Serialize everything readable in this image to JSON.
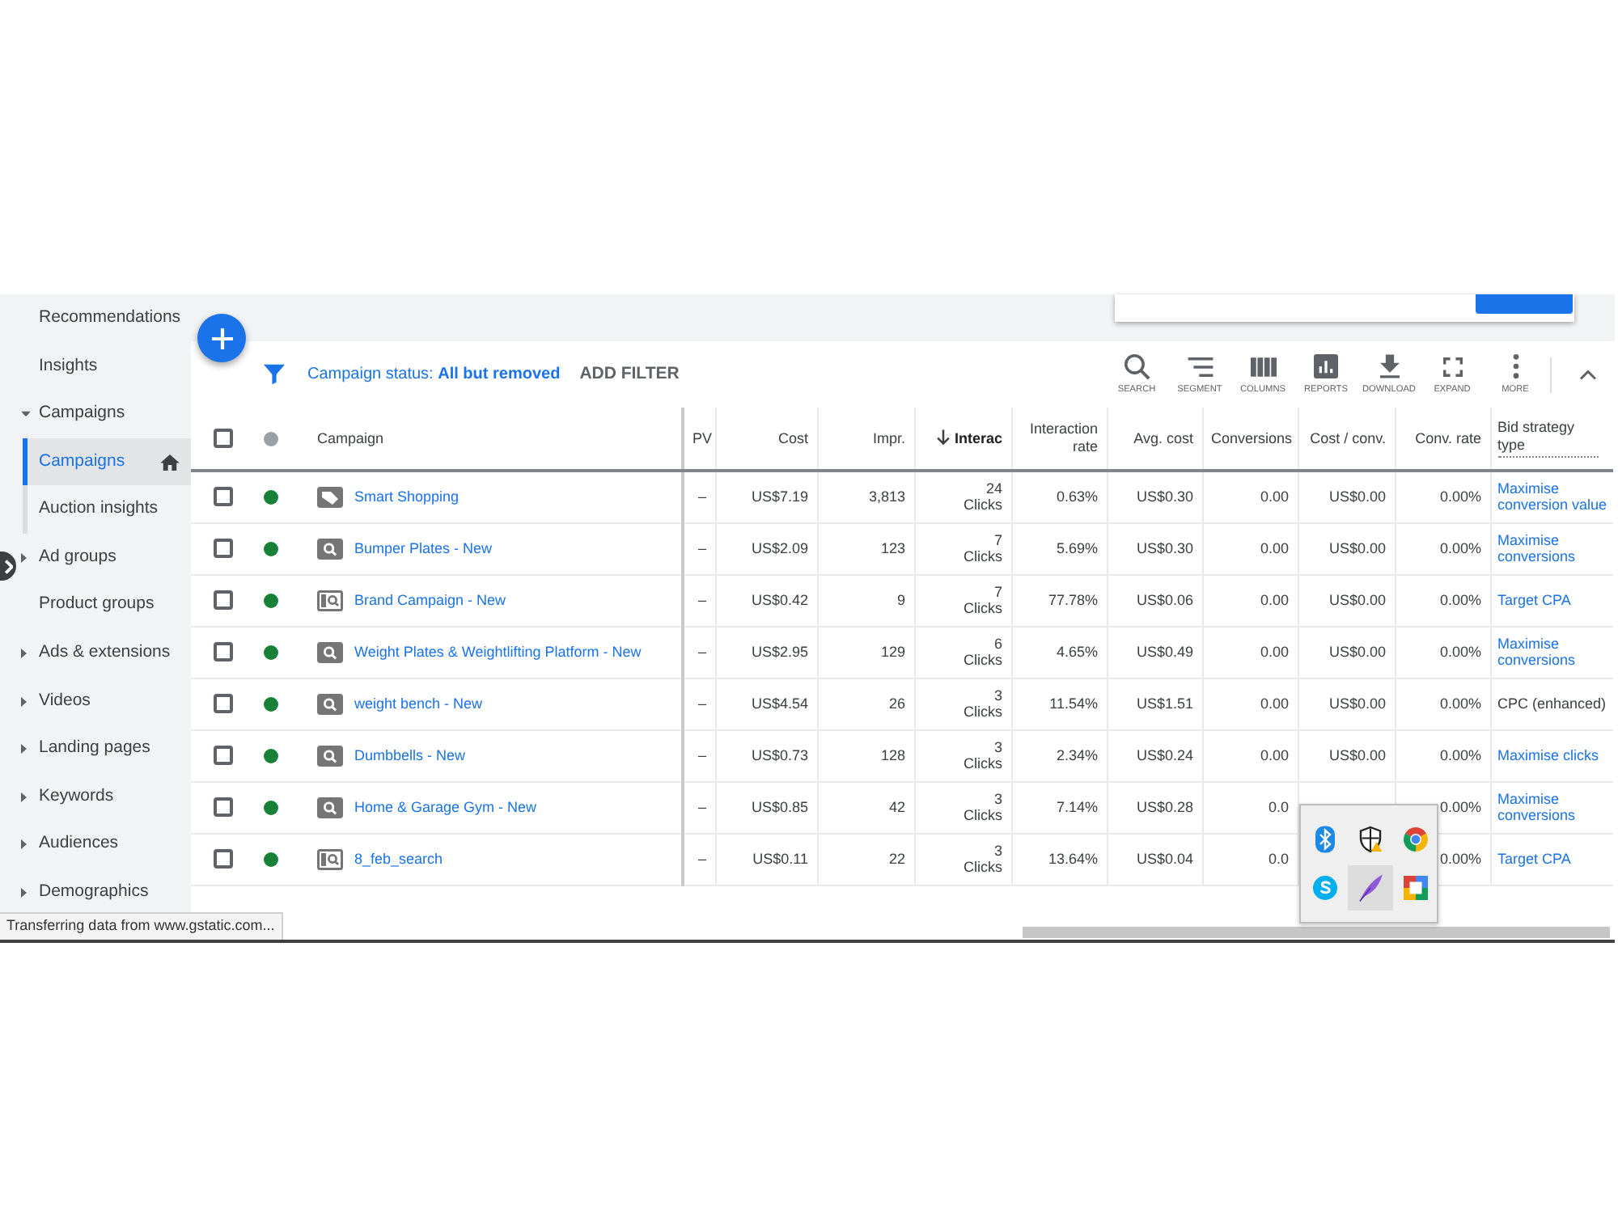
{
  "sidebar": {
    "items": [
      {
        "label": "Recommendations",
        "kind": "page",
        "selected": false
      },
      {
        "label": "Insights",
        "kind": "page",
        "selected": false
      },
      {
        "label": "Campaigns",
        "kind": "section",
        "expanded": true,
        "selected": false,
        "children": [
          {
            "label": "Campaigns",
            "selected": true,
            "home": true
          },
          {
            "label": "Auction insights",
            "selected": false,
            "home": false
          }
        ]
      },
      {
        "label": "Ad groups",
        "kind": "section",
        "expanded": false,
        "selected": false
      },
      {
        "label": "Product groups",
        "kind": "page",
        "selected": false
      },
      {
        "label": "Ads & extensions",
        "kind": "section",
        "expanded": false,
        "selected": false
      },
      {
        "label": "Videos",
        "kind": "section",
        "expanded": false,
        "selected": false
      },
      {
        "label": "Landing pages",
        "kind": "section",
        "expanded": false,
        "selected": false
      },
      {
        "label": "Keywords",
        "kind": "section",
        "expanded": false,
        "selected": false
      },
      {
        "label": "Audiences",
        "kind": "section",
        "expanded": false,
        "selected": false
      },
      {
        "label": "Demographics",
        "kind": "section",
        "expanded": false,
        "selected": false
      }
    ]
  },
  "filter_bar": {
    "filter": "Campaign status: **All but removed**",
    "add_filter": "ADD FILTER"
  },
  "toolbar": {
    "buttons": [
      {
        "kind": "search",
        "label": "SEARCH"
      },
      {
        "kind": "segment",
        "label": "SEGMENT"
      },
      {
        "kind": "columns",
        "label": "COLUMNS"
      },
      {
        "kind": "reports",
        "label": "REPORTS"
      },
      {
        "kind": "download",
        "label": "DOWNLOAD"
      },
      {
        "kind": "expand",
        "label": "EXPAND"
      },
      {
        "kind": "more",
        "label": "MORE"
      }
    ]
  },
  "table": {
    "header_checkbox": {
      "checked": false
    },
    "columns": [
      {
        "label": "Campaign",
        "kind": "name",
        "sorted": false
      },
      {
        "label": "PV",
        "kind": "number",
        "sorted": false
      },
      {
        "label": "Cost",
        "kind": "number",
        "sorted": false
      },
      {
        "label": "Impr.",
        "kind": "number",
        "sorted": false
      },
      {
        "label": "Interac",
        "kind": "number",
        "sorted": true
      },
      {
        "label": "Interaction rate",
        "kind": "number",
        "sorted": false
      },
      {
        "label": "Avg. cost",
        "kind": "number",
        "sorted": false
      },
      {
        "label": "Conversions",
        "kind": "number",
        "sorted": false
      },
      {
        "label": "Cost / conv.",
        "kind": "number",
        "sorted": false
      },
      {
        "label": "Conv. rate",
        "kind": "number",
        "sorted": false
      },
      {
        "label": "Bid strategy type",
        "kind": "strategy",
        "sorted": false
      }
    ],
    "rows": [
      {
        "selected": false,
        "enabled": true,
        "kind": "shopping",
        "name": "Smart Shopping",
        "pv": "–",
        "cost": "US$7.19",
        "impr": "3,813",
        "interactions": "24",
        "interaction_unit": "Clicks",
        "interaction_rate": "0.63%",
        "avg_cost": "US$0.30",
        "conversions": "0.00",
        "cost_per_conv": "US$0.00",
        "conv_rate": "0.00%",
        "bid_strategy": "Maximise conversion value",
        "bid_strategy_link": true
      },
      {
        "selected": false,
        "enabled": true,
        "kind": "search",
        "name": "Bumper Plates - New",
        "pv": "–",
        "cost": "US$2.09",
        "impr": "123",
        "interactions": "7",
        "interaction_unit": "Clicks",
        "interaction_rate": "5.69%",
        "avg_cost": "US$0.30",
        "conversions": "0.00",
        "cost_per_conv": "US$0.00",
        "conv_rate": "0.00%",
        "bid_strategy": "Maximise conversions",
        "bid_strategy_link": true
      },
      {
        "selected": false,
        "enabled": true,
        "kind": "search_display",
        "name": "Brand Campaign - New",
        "pv": "–",
        "cost": "US$0.42",
        "impr": "9",
        "interactions": "7",
        "interaction_unit": "Clicks",
        "interaction_rate": "77.78%",
        "avg_cost": "US$0.06",
        "conversions": "0.00",
        "cost_per_conv": "US$0.00",
        "conv_rate": "0.00%",
        "bid_strategy": "Target CPA",
        "bid_strategy_link": true
      },
      {
        "selected": false,
        "enabled": true,
        "kind": "search",
        "name": "Weight Plates & Weightlifting Platform - New",
        "pv": "–",
        "cost": "US$2.95",
        "impr": "129",
        "interactions": "6",
        "interaction_unit": "Clicks",
        "interaction_rate": "4.65%",
        "avg_cost": "US$0.49",
        "conversions": "0.00",
        "cost_per_conv": "US$0.00",
        "conv_rate": "0.00%",
        "bid_strategy": "Maximise conversions",
        "bid_strategy_link": true
      },
      {
        "selected": false,
        "enabled": true,
        "kind": "search",
        "name": "weight bench - New",
        "pv": "–",
        "cost": "US$4.54",
        "impr": "26",
        "interactions": "3",
        "interaction_unit": "Clicks",
        "interaction_rate": "11.54%",
        "avg_cost": "US$1.51",
        "conversions": "0.00",
        "cost_per_conv": "US$0.00",
        "conv_rate": "0.00%",
        "bid_strategy": "CPC (enhanced)",
        "bid_strategy_link": false
      },
      {
        "selected": false,
        "enabled": true,
        "kind": "search",
        "name": "Dumbbells - New",
        "pv": "–",
        "cost": "US$0.73",
        "impr": "128",
        "interactions": "3",
        "interaction_unit": "Clicks",
        "interaction_rate": "2.34%",
        "avg_cost": "US$0.24",
        "conversions": "0.00",
        "cost_per_conv": "US$0.00",
        "conv_rate": "0.00%",
        "bid_strategy": "Maximise clicks",
        "bid_strategy_link": true
      },
      {
        "selected": false,
        "enabled": true,
        "kind": "search",
        "name": "Home & Garage Gym - New",
        "pv": "–",
        "cost": "US$0.85",
        "impr": "42",
        "interactions": "3",
        "interaction_unit": "Clicks",
        "interaction_rate": "7.14%",
        "avg_cost": "US$0.28",
        "conversions": "0.0",
        "conv_rate": "0.00%",
        "bid_strategy": "Maximise conversions",
        "bid_strategy_link": true
      },
      {
        "selected": false,
        "enabled": true,
        "kind": "search_display",
        "name": "8_feb_search",
        "pv": "–",
        "cost": "US$0.11",
        "impr": "22",
        "interactions": "3",
        "interaction_unit": "Clicks",
        "interaction_rate": "13.64%",
        "avg_cost": "US$0.04",
        "conversions": "0.0",
        "conv_rate": "0.00%",
        "bid_strategy": "Target CPA",
        "bid_strategy_link": true
      }
    ]
  },
  "status_bar": "Transferring data from www.gstatic.com...",
  "tray_popup": {
    "icons": [
      {
        "kind": "bluetooth",
        "selected": false
      },
      {
        "kind": "shield",
        "selected": false
      },
      {
        "kind": "round_logo",
        "selected": false
      },
      {
        "kind": "curve_badge",
        "selected": false
      },
      {
        "kind": "quill",
        "selected": true
      },
      {
        "kind": "tile",
        "selected": false
      }
    ]
  }
}
